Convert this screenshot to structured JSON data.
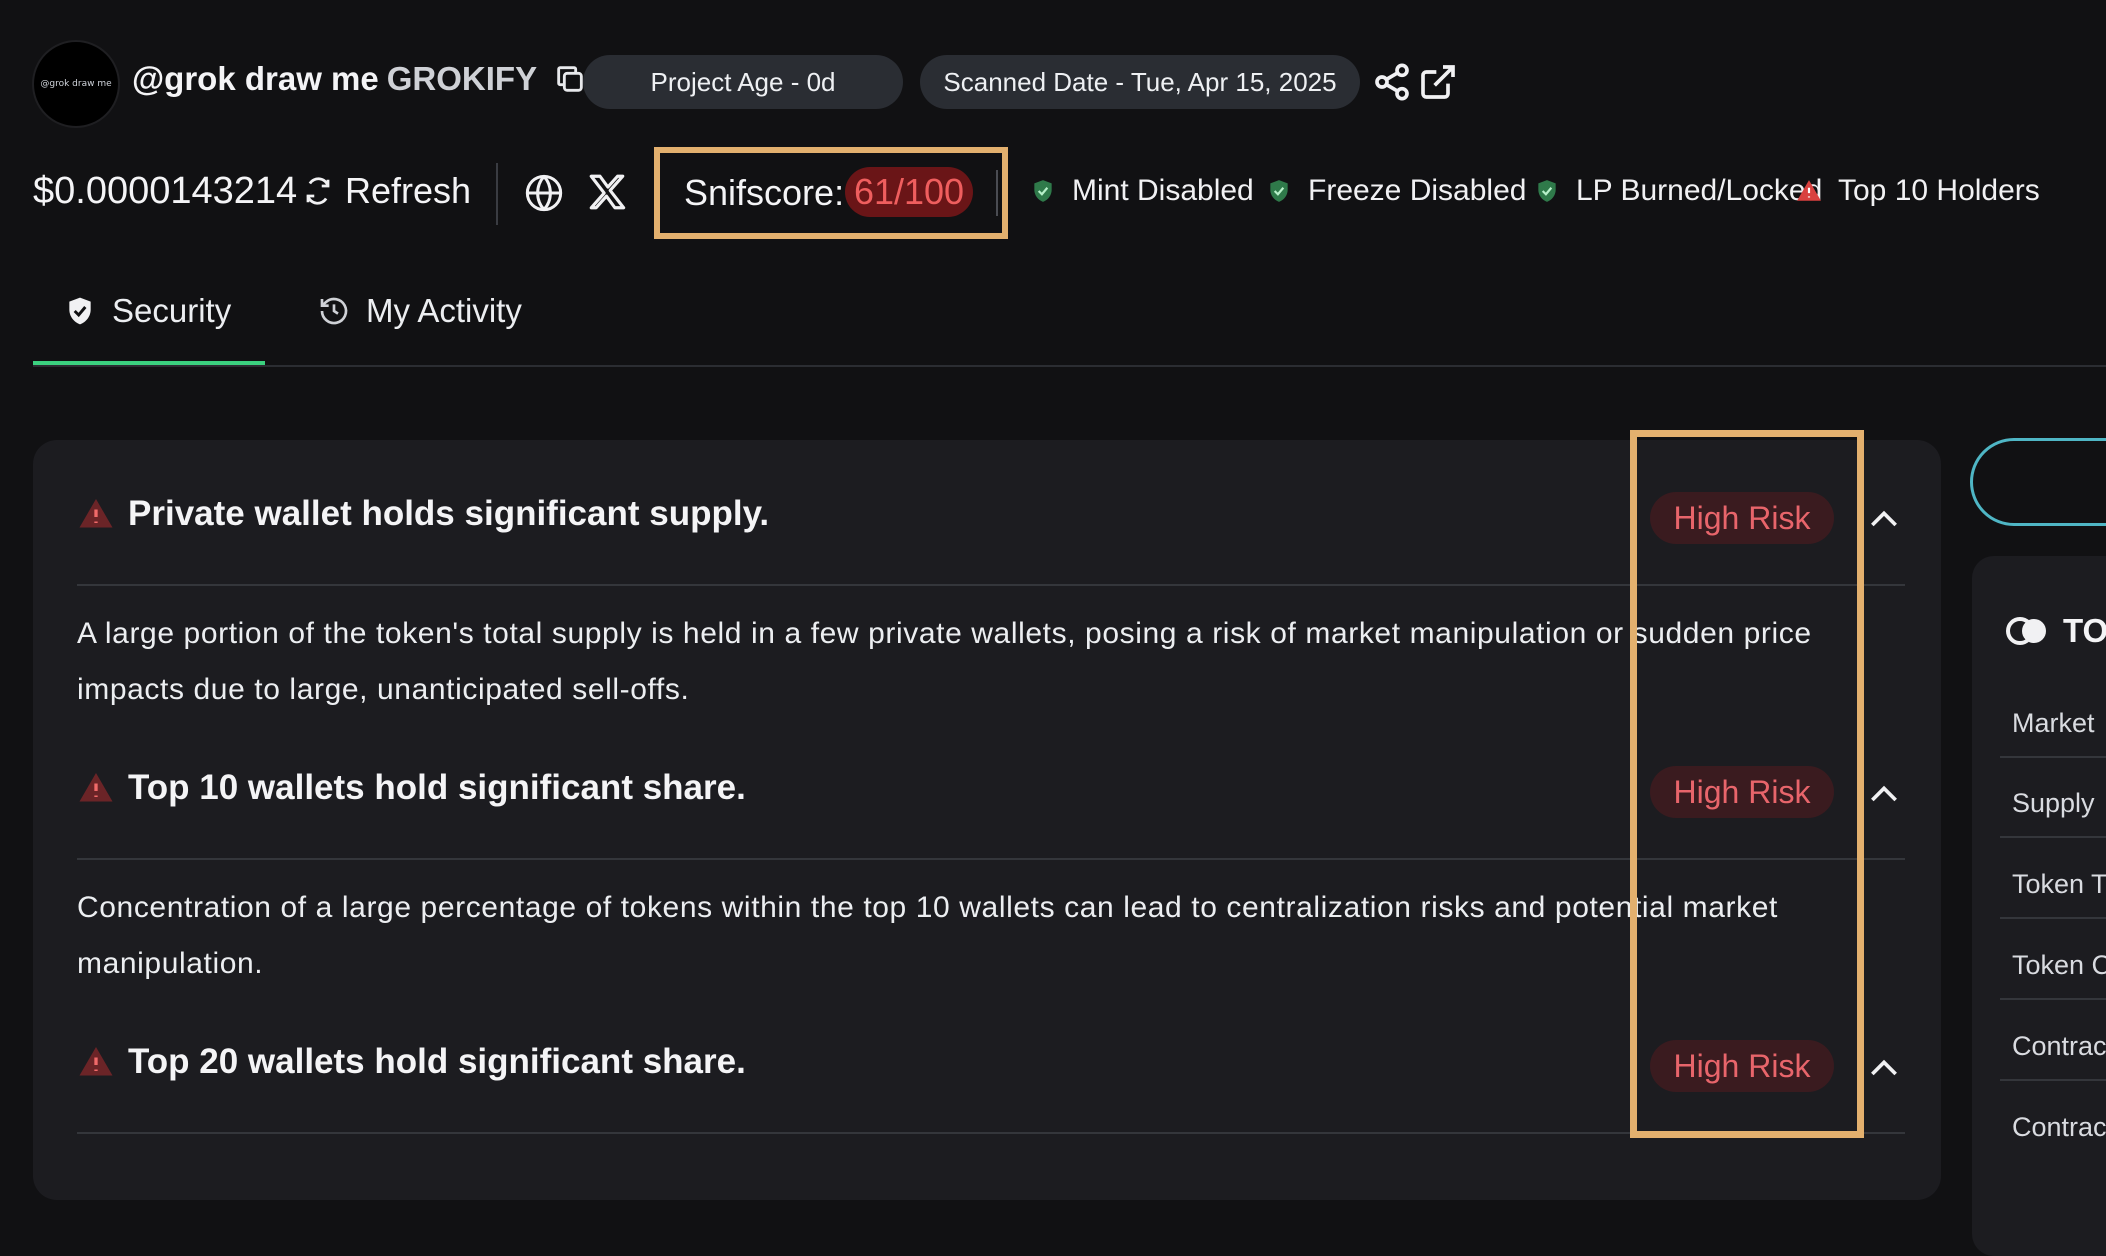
{
  "header": {
    "avatar_text": "@grok draw me",
    "token_name": "@grok draw me",
    "token_symbol": "GROKIFY",
    "project_age": "Project Age - 0d",
    "scanned_date": "Scanned Date - Tue, Apr 15, 2025"
  },
  "toolbar": {
    "price": "$0.0000143214",
    "refresh_label": "Refresh",
    "snifscore_label": "Snifscore:",
    "snifscore_value": "61/100",
    "statuses": [
      {
        "label": "Mint Disabled",
        "icon": "shield-check-icon"
      },
      {
        "label": "Freeze Disabled",
        "icon": "shield-check-icon"
      },
      {
        "label": "LP Burned/Locked",
        "icon": "shield-check-icon"
      },
      {
        "label": "Top 10 Holders",
        "icon": "warning-icon"
      }
    ]
  },
  "tabs": [
    {
      "label": "Security",
      "icon": "shield-icon",
      "active": true
    },
    {
      "label": "My Activity",
      "icon": "history-icon",
      "active": false
    }
  ],
  "risks": [
    {
      "title": "Private wallet holds significant supply.",
      "badge": "High Risk",
      "description": "A large portion of the token's total supply is held in a few private wallets, posing a risk of market manipulation or sudden price impacts due to large, unanticipated sell-offs."
    },
    {
      "title": "Top 10 wallets hold significant share.",
      "badge": "High Risk",
      "description": "Concentration of a large percentage of tokens within the top 10 wallets can lead to centralization risks and potential market manipulation."
    },
    {
      "title": "Top 20 wallets hold significant share.",
      "badge": "High Risk"
    }
  ],
  "right_panel": {
    "heading": "TO",
    "rows": [
      "Market",
      "Supply",
      "Token T",
      "Token C",
      "Contrac",
      "Contrac"
    ]
  },
  "colors": {
    "accent_green": "#3bd17f",
    "risk_red": "#e8656b",
    "highlight": "#e3b06e",
    "background": "#111113"
  }
}
